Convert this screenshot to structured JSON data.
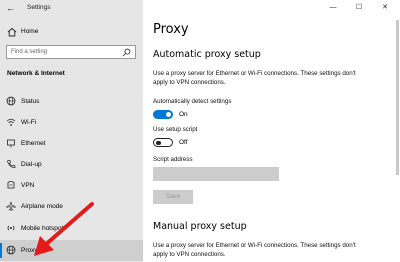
{
  "window": {
    "title": "Settings"
  },
  "titlebar": {
    "minimize": "—",
    "maximize": "☐",
    "close": "✕"
  },
  "sidebar": {
    "home_label": "Home",
    "search_placeholder": "Find a setting",
    "section_title": "Network & Internet",
    "items": [
      {
        "label": "Status",
        "icon": "globe-icon"
      },
      {
        "label": "Wi-Fi",
        "icon": "wifi-icon"
      },
      {
        "label": "Ethernet",
        "icon": "ethernet-icon"
      },
      {
        "label": "Dial-up",
        "icon": "phone-icon"
      },
      {
        "label": "VPN",
        "icon": "vpn-icon"
      },
      {
        "label": "Airplane mode",
        "icon": "airplane-icon"
      },
      {
        "label": "Mobile hotspot",
        "icon": "hotspot-icon"
      },
      {
        "label": "Proxy",
        "icon": "globe-icon",
        "selected": true
      }
    ],
    "accent": "#0078d7"
  },
  "main": {
    "title": "Proxy",
    "auto": {
      "heading": "Automatic proxy setup",
      "desc": "Use a proxy server for Ethernet or Wi-Fi connections. These settings don't apply to VPN connections.",
      "detect_label": "Automatically detect settings",
      "detect_state": "On",
      "script_label": "Use setup script",
      "script_state": "Off",
      "address_label": "Script address",
      "save_label": "Save"
    },
    "manual": {
      "heading": "Manual proxy setup",
      "desc": "Use a proxy server for Ethernet or Wi-Fi connections. These settings don't apply to VPN connections."
    }
  }
}
